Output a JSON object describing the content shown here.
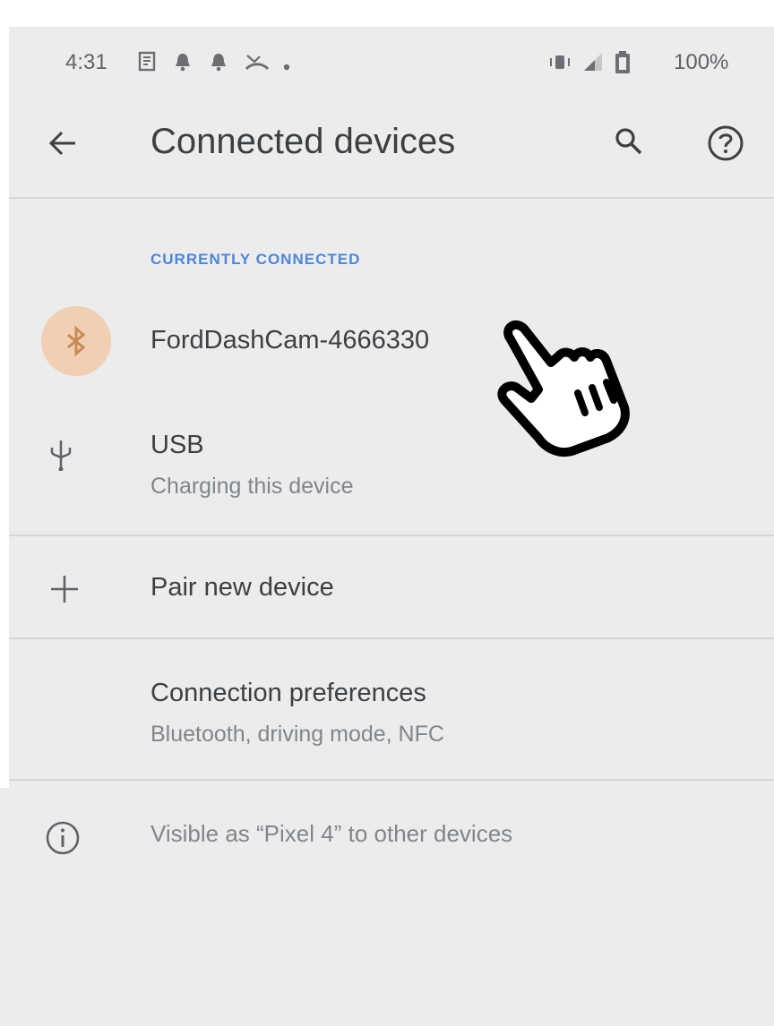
{
  "status_bar": {
    "time": "4:31",
    "left_icons": [
      "news-icon",
      "bell-icon",
      "bell-icon",
      "missed-call-icon",
      "dot-icon"
    ],
    "right_icons": [
      "vibrate-icon",
      "signal-icon",
      "battery-icon"
    ],
    "battery": "100%"
  },
  "app_bar": {
    "title": "Connected devices",
    "back_icon": "back-arrow-icon",
    "actions": [
      "search-icon",
      "help-icon"
    ]
  },
  "sections": {
    "currently_connected": {
      "header": "CURRENTLY CONNECTED",
      "items": [
        {
          "label": "FordDashCam-4666330",
          "icon": "bluetooth-icon"
        },
        {
          "label": "USB",
          "sublabel": "Charging this device",
          "icon": "usb-icon"
        }
      ]
    },
    "pair": {
      "label": "Pair new device",
      "icon": "plus-icon"
    },
    "preferences": {
      "label": "Connection preferences",
      "sublabel": "Bluetooth, driving mode, NFC"
    },
    "info": {
      "label": "Visible as “Pixel 4” to other devices",
      "icon": "info-icon"
    }
  },
  "colors": {
    "background": "#ececec",
    "accent": "#4e86d8",
    "bluetooth_circle": "#f1cfb2",
    "bluetooth_icon": "#c98b55",
    "primary_text": "#3c4043",
    "secondary_text": "#80868b"
  },
  "overlay": {
    "icon": "pointing-hand-cursor-icon"
  }
}
